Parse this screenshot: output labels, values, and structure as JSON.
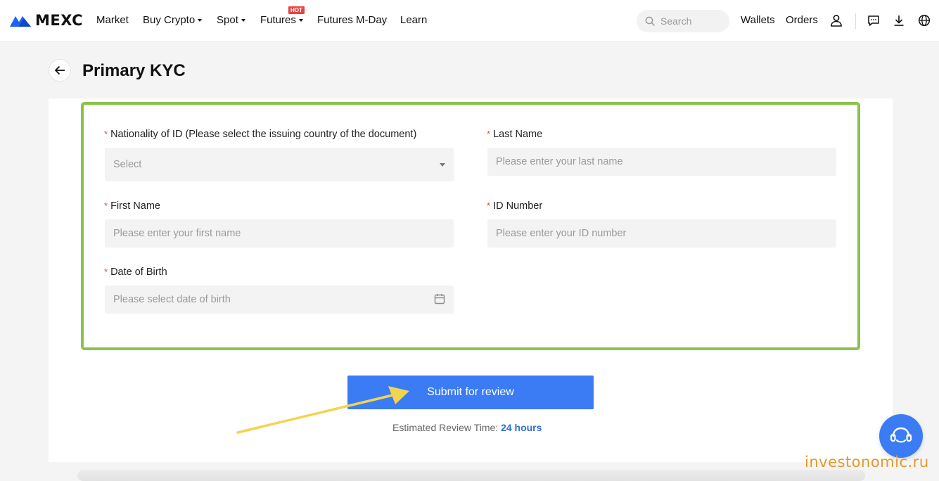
{
  "brand": {
    "name": "MEXC"
  },
  "nav": {
    "items": [
      {
        "label": "Market"
      },
      {
        "label": "Buy Crypto"
      },
      {
        "label": "Spot"
      },
      {
        "label": "Futures"
      },
      {
        "label": "Futures M-Day"
      },
      {
        "label": "Learn"
      }
    ],
    "hot_badge": "HOT",
    "search_placeholder": "Search",
    "wallets": "Wallets",
    "orders": "Orders",
    "icons": [
      "user-icon",
      "chat-icon",
      "download-icon",
      "globe-icon"
    ]
  },
  "page": {
    "title": "Primary KYC"
  },
  "form": {
    "nationality": {
      "label": "Nationality of ID (Please select the issuing country of the document)",
      "value": "Select"
    },
    "last_name": {
      "label": "Last Name",
      "placeholder": "Please enter your last name"
    },
    "first_name": {
      "label": "First Name",
      "placeholder": "Please enter your first name"
    },
    "id_number": {
      "label": "ID Number",
      "placeholder": "Please enter your ID number"
    },
    "dob": {
      "label": "Date of Birth",
      "placeholder": "Please select date of birth"
    },
    "required_mark": "*"
  },
  "submit": {
    "label": "Submit for review"
  },
  "review": {
    "prefix": "Estimated Review Time:",
    "value": "24 hours"
  },
  "watermark": "investonomic.ru",
  "colors": {
    "accent": "#3b7cf4",
    "highlight_frame": "#8bc34a",
    "annotation_arrow": "#f2d44e",
    "required": "#e8443f"
  }
}
